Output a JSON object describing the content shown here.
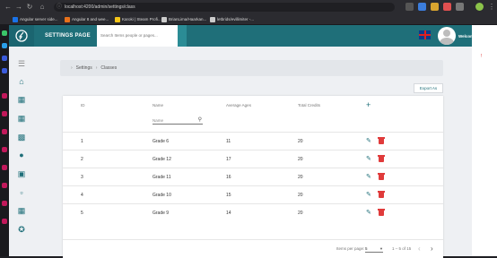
{
  "browser": {
    "url": "localhost:4200/admin/settings/class",
    "bookmarks": [
      {
        "label": "Angular server side...",
        "color": "#1a73e8"
      },
      {
        "label": "Angular 8 and wee...",
        "color": "#e8711a"
      },
      {
        "label": "Karoki | Steam Profi...",
        "color": "#f5c518"
      },
      {
        "label": "BrianLima/Haarkan...",
        "color": "#cccccc"
      },
      {
        "label": "letbrids/evillimiter -...",
        "color": "#cccccc"
      }
    ]
  },
  "header": {
    "title": "SETTINGS PAGE",
    "search_placeholder": "Search Items people or pages...",
    "welcome": "Welcome"
  },
  "sidebar": {
    "icons": [
      "menu-icon",
      "home-icon",
      "calendar-icon",
      "calendar-grid-icon",
      "id-card-icon",
      "people-icon",
      "teacher-icon",
      "assignment-icon",
      "schedule-icon",
      "award-icon"
    ]
  },
  "breadcrumb": {
    "parent": "Settings",
    "current": "Classes"
  },
  "toolbar": {
    "export_label": "Export As"
  },
  "table": {
    "columns": [
      "ID",
      "Name",
      "Average Ages",
      "Total Credits"
    ],
    "name_filter_placeholder": "Name",
    "rows": [
      {
        "id": "1",
        "name": "Grade 6",
        "avg_ages": "11",
        "credits": "20"
      },
      {
        "id": "2",
        "name": "Grade 12",
        "avg_ages": "17",
        "credits": "20"
      },
      {
        "id": "3",
        "name": "Grade 11",
        "avg_ages": "16",
        "credits": "20"
      },
      {
        "id": "4",
        "name": "Grade 10",
        "avg_ages": "15",
        "credits": "20"
      },
      {
        "id": "5",
        "name": "Grade 9",
        "avg_ages": "14",
        "credits": "20"
      }
    ]
  },
  "pagination": {
    "items_per_page_label": "Items per page:",
    "items_per_page": "5",
    "range": "1 – 5 of 15"
  },
  "colors": {
    "primary": "#1f6f79",
    "delete": "#e03b3b"
  }
}
